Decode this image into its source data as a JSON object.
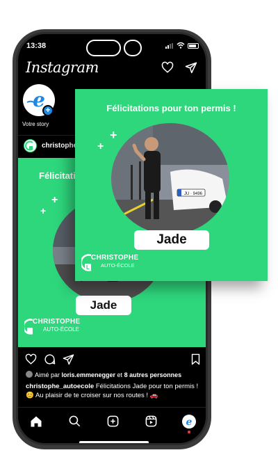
{
  "status_bar": {
    "time": "13:38"
  },
  "header": {
    "app_name": "Instagram"
  },
  "stories": [
    {
      "label": "Votre story"
    }
  ],
  "post": {
    "username": "christophe_autoecole",
    "image_title": "Félicitations pour ton permis !",
    "name_label": "Jade",
    "brand_line1": "CHRISTOPHE",
    "brand_line2": "AUTO-ÉCOLE",
    "plate": "JU · 9496",
    "likes_text_prefix": "Aimé par ",
    "likes_user": "loris.emmenegger",
    "likes_text_mid": " et ",
    "likes_others": "8 autres personnes",
    "caption_user": "christophe_autoecole",
    "caption_text": " Félicitations Jade pour ton permis ! 😊 Au plaisir de te croiser sur nos routes ! 🚗"
  },
  "overlay": {
    "title": "Félicitations pour ton permis !",
    "name_label": "Jade",
    "brand_line1": "CHRISTOPHE",
    "brand_line2": "AUTO-ÉCOLE"
  },
  "icons": {
    "header": [
      "heart-icon",
      "send-icon"
    ],
    "actions": [
      "like-icon",
      "comment-icon",
      "share-icon",
      "save-icon"
    ],
    "nav": [
      "home-icon",
      "search-icon",
      "create-icon",
      "reels-icon",
      "profile-icon"
    ]
  },
  "colors": {
    "brand_green": "#2ed67c",
    "app_bg": "#000000",
    "accent_blue": "#1e88e5"
  }
}
